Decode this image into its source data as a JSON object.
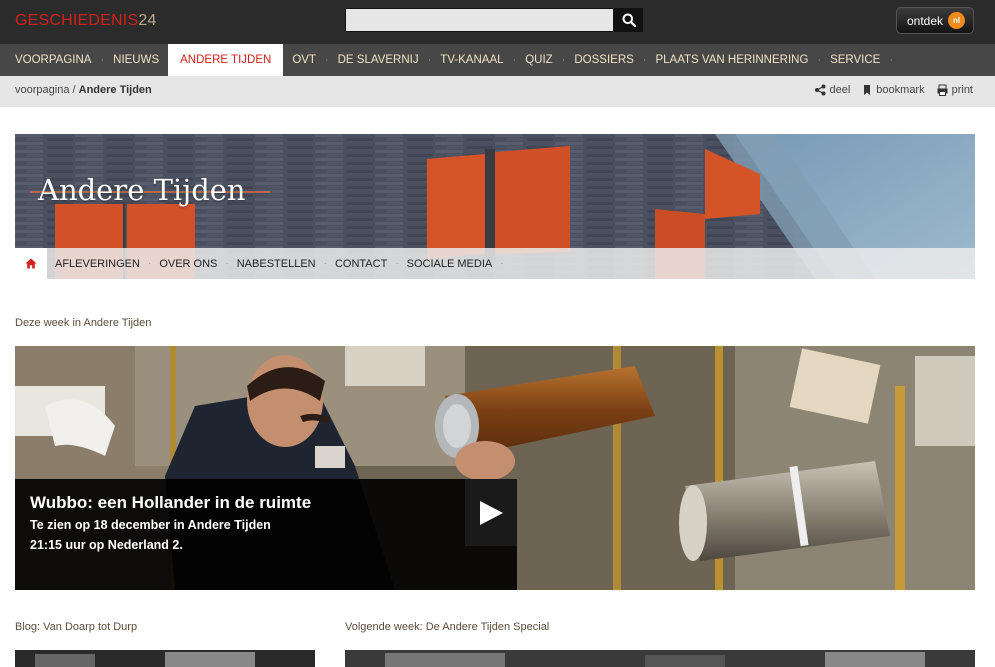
{
  "header": {
    "logo_word": "GESCHIEDENIS",
    "logo_number": "24",
    "search_placeholder": "",
    "search_icon": "search-icon",
    "ontdek_label": "ontdek",
    "ontdek_badge": "nl"
  },
  "mainnav": {
    "items": [
      {
        "label": "VOORPAGINA",
        "active": false
      },
      {
        "label": "NIEUWS",
        "active": false
      },
      {
        "label": "ANDERE TIJDEN",
        "active": true
      },
      {
        "label": "OVT",
        "active": false
      },
      {
        "label": "DE SLAVERNIJ",
        "active": false
      },
      {
        "label": "TV-KANAAL",
        "active": false
      },
      {
        "label": "QUIZ",
        "active": false
      },
      {
        "label": "DOSSIERS",
        "active": false
      },
      {
        "label": "PLAATS VAN HERINNERING",
        "active": false
      },
      {
        "label": "SERVICE",
        "active": false
      }
    ],
    "separator": "·"
  },
  "breadcrumb": {
    "home": "voorpagina",
    "separator": "/",
    "current": "Andere Tijden"
  },
  "tools": {
    "share": "deel",
    "bookmark": "bookmark",
    "print": "print"
  },
  "banner": {
    "title": "Andere Tijden"
  },
  "subnav": {
    "items": [
      "AFLEVERINGEN",
      "OVER ONS",
      "NABESTELLEN",
      "CONTACT",
      "SOCIALE MEDIA"
    ],
    "separator": "·"
  },
  "feature": {
    "section_label": "Deze week in Andere Tijden",
    "title": "Wubbo: een Hollander in de ruimte",
    "line1": "Te zien op 18 december in Andere Tijden",
    "line2": "21:15 uur op Nederland 2."
  },
  "lower": {
    "left_label": "Blog: Van Doarp tot Durp",
    "right_label": "Volgende week: De Andere Tijden Special"
  },
  "colors": {
    "brand_red": "#d0211b",
    "nav_bg": "#474747",
    "topbar_bg": "#2b2b2b",
    "nav_text": "#efe3c5",
    "label_text": "#5b4e3a"
  }
}
